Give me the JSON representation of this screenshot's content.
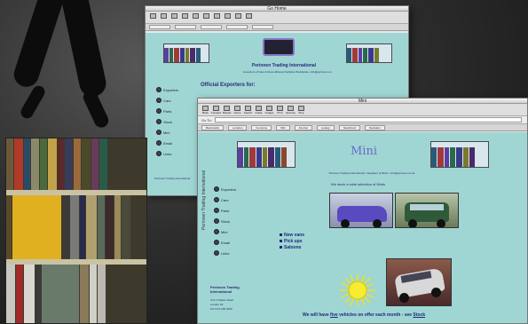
{
  "back_window": {
    "title": "Go Home",
    "site_name": "Perinnen Trading International",
    "tagline": "Exporters of New & Reconditioned Vehicles Worldwide • info@perinnen.co",
    "heading": "Official Exporters for:",
    "nav_items": [
      "Exporters",
      "Cars",
      "Parts",
      "Stock",
      "Mini",
      "Email",
      "Links"
    ],
    "footer": "Perinnen Trading International"
  },
  "front_window": {
    "title": "Mini",
    "page_title": "Mini",
    "url_label": "Go To:",
    "toolbar_buttons": [
      "Back",
      "Forward",
      "Reload",
      "Home",
      "Search",
      "Guide",
      "Images",
      "Print",
      "Security",
      "Stop"
    ],
    "bookmarks": [
      "Bookmarks",
      "Location",
      "Go Home",
      "Mini",
      "Internet",
      "Lookup",
      "New&Cool",
      "Netcaster"
    ],
    "tagline": "Perinnen Trading International • Suppliers of Minis • info@perinnen.co.uk",
    "subhead": "We stock a wide selection of Minis",
    "nav_items": [
      "Exporters",
      "Cars",
      "Parts",
      "Stock",
      "Mini",
      "Email",
      "Links"
    ],
    "links": [
      "New vans",
      "Pick ups",
      "Saloons"
    ],
    "company_block": [
      "Perinnen Trading",
      "International",
      "",
      "Unit 4 Station Road",
      "London N1",
      "Tel 0171 000 0000"
    ],
    "vertical_text": "Perinnen Trading International",
    "footer_text": "We will have",
    "footer_link": "five",
    "footer_text2": "vehicles on offer each month - see",
    "footer_link2": "Stock"
  },
  "colors": {
    "page_bg": "#9fd6d4",
    "link": "#202878",
    "title": "#6a6ac8"
  }
}
